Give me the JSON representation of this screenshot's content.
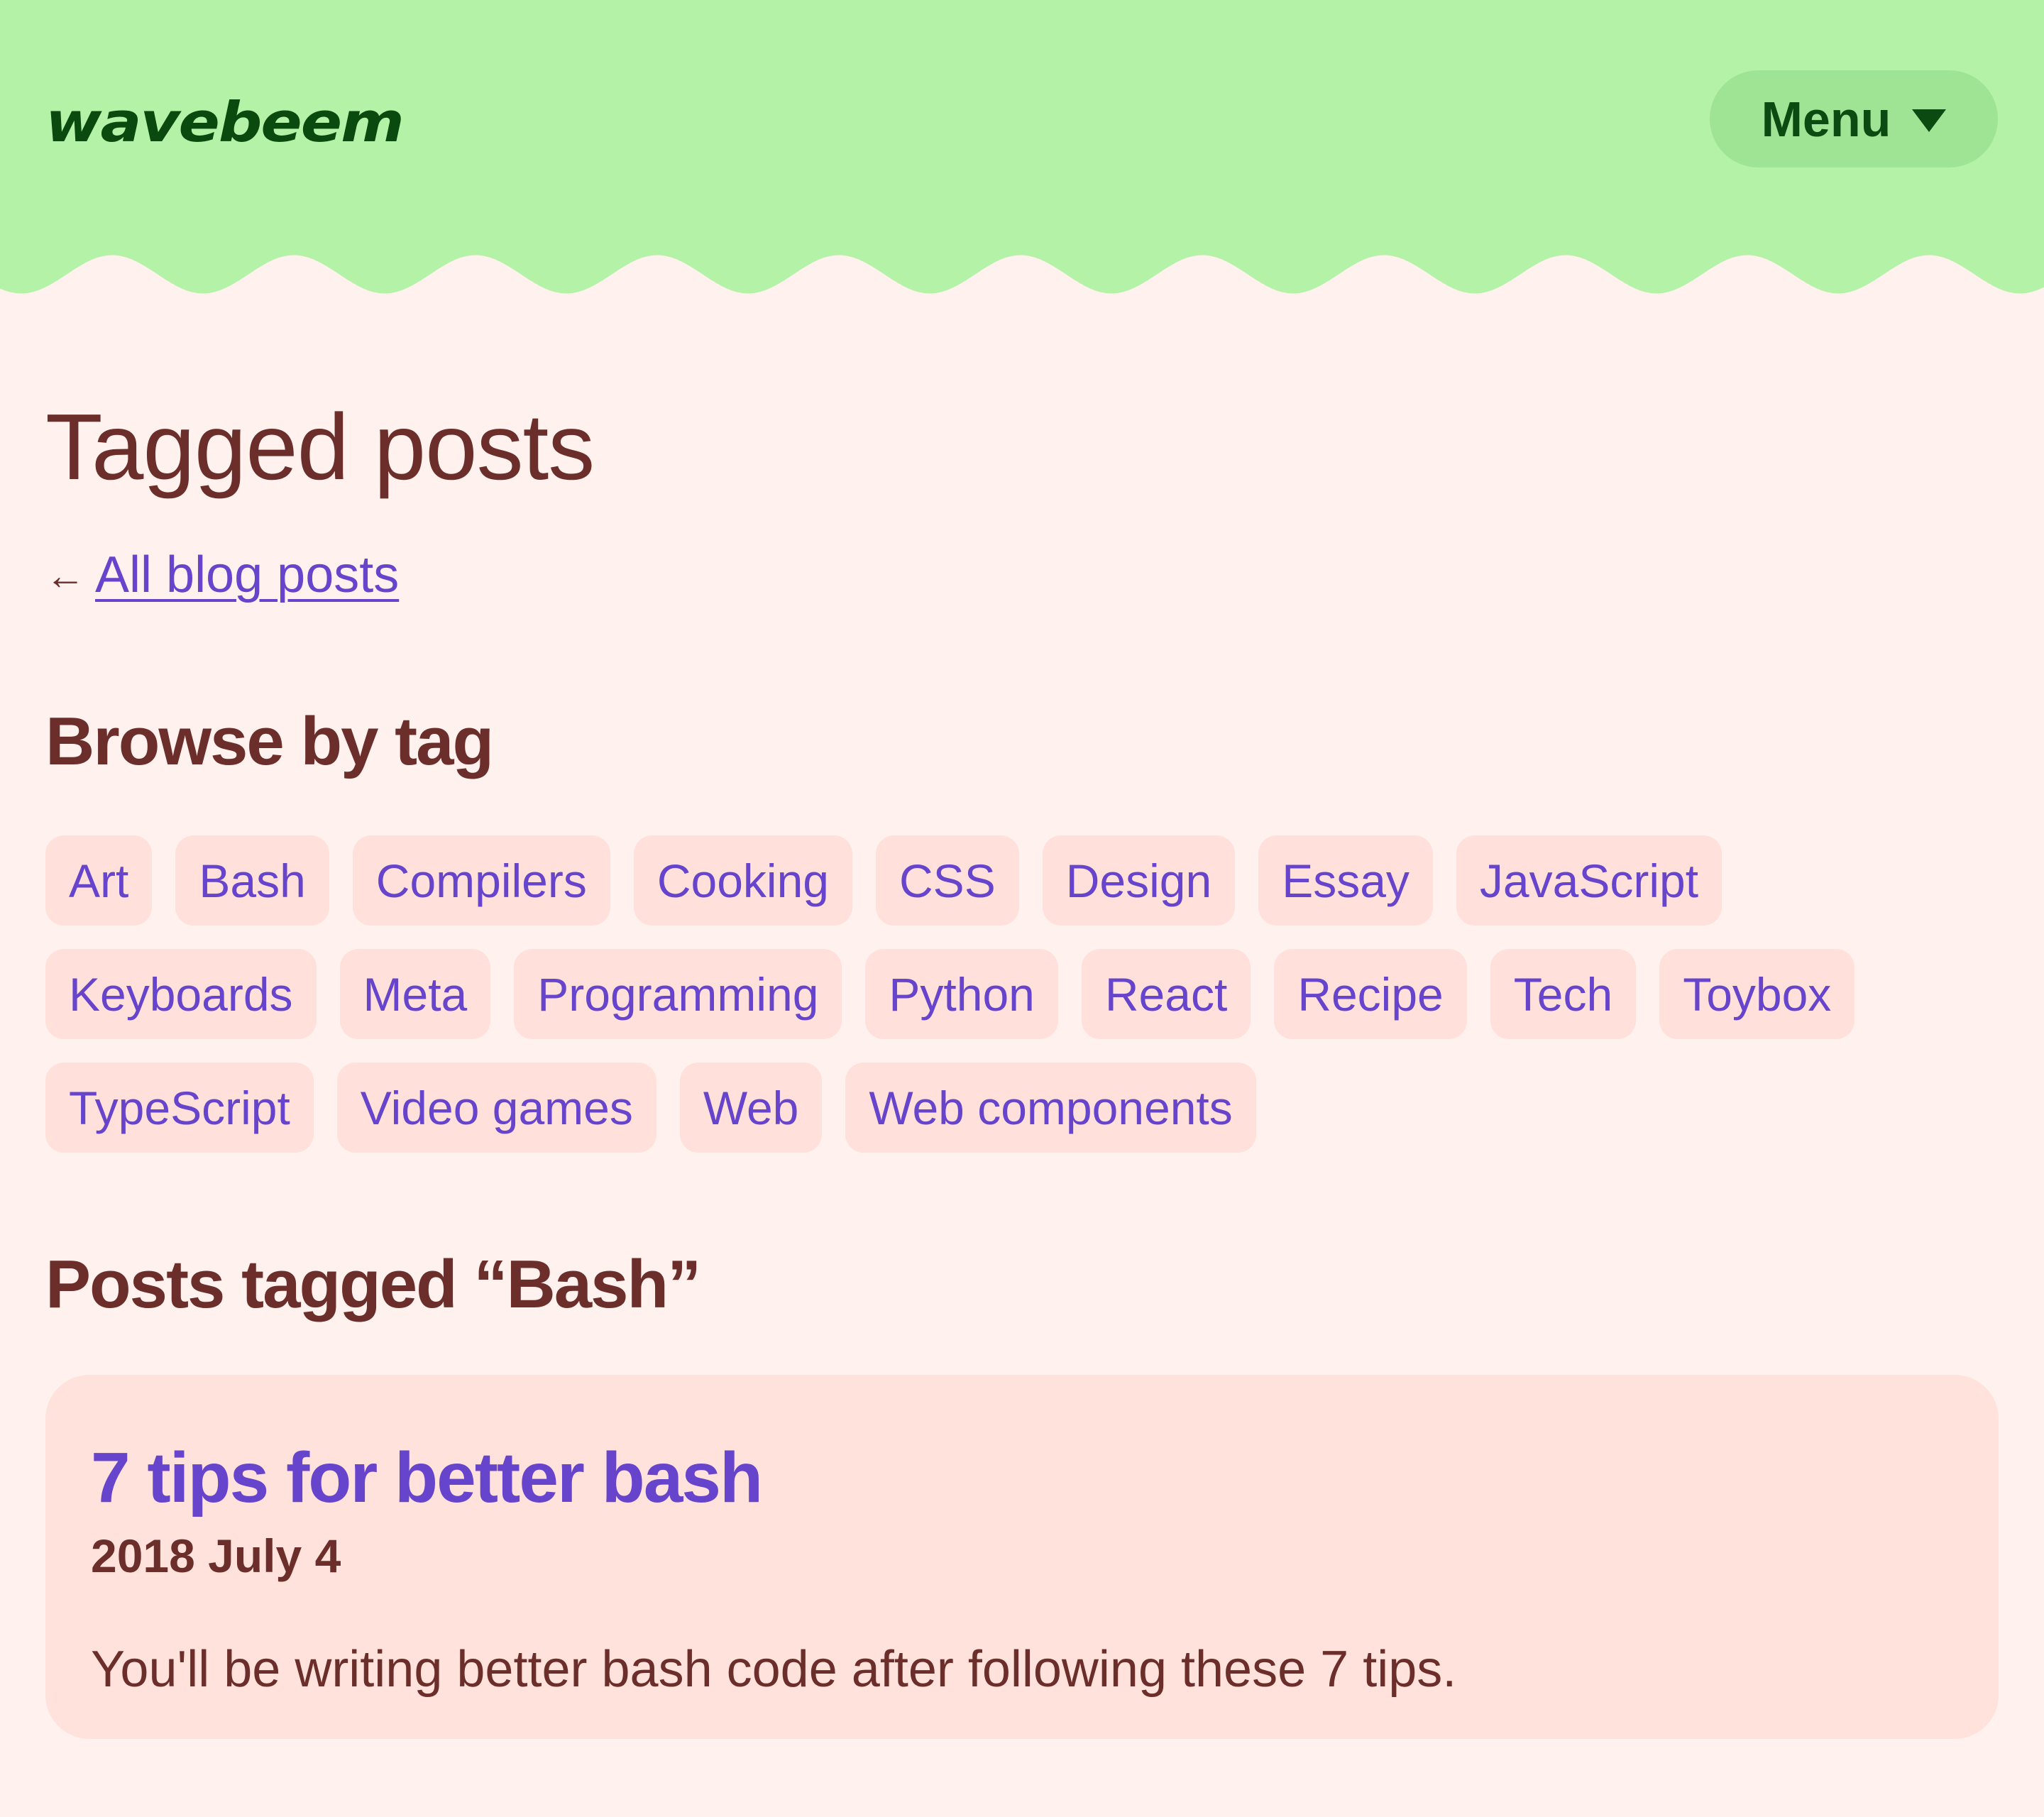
{
  "header": {
    "logo_text": "wavebeem",
    "menu_label": "Menu",
    "background_color": "#b3f2a7",
    "logo_color": "#0a4a0e"
  },
  "page": {
    "title": "Tagged posts",
    "back_arrow": "←",
    "back_link_label": "All blog posts",
    "background_color": "#fff1ed",
    "text_color": "#6b2e2a",
    "link_color": "#6644cc"
  },
  "browse": {
    "heading": "Browse by tag",
    "tags": [
      "Art",
      "Bash",
      "Compilers",
      "Cooking",
      "CSS",
      "Design",
      "Essay",
      "JavaScript",
      "Keyboards",
      "Meta",
      "Programming",
      "Python",
      "React",
      "Recipe",
      "Tech",
      "Toybox",
      "TypeScript",
      "Video games",
      "Web",
      "Web components"
    ]
  },
  "posts_section": {
    "heading": "Posts tagged “Bash”",
    "posts": [
      {
        "title": "7 tips for better bash",
        "date": "2018 July 4",
        "excerpt": "You'll be writing better bash code after following these 7 tips."
      }
    ]
  },
  "icons": {
    "back": "arrow-left-icon",
    "menu_caret": "caret-down-icon"
  }
}
